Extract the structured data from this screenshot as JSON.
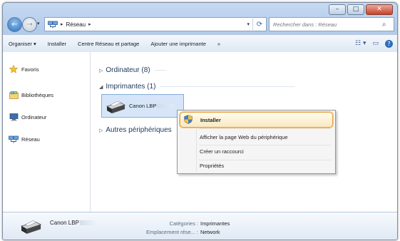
{
  "window": {
    "minimize_glyph": "–",
    "maximize_glyph": "□",
    "close_glyph": "✕"
  },
  "address_bar": {
    "icon": "network-icon",
    "crumbs": [
      "Réseau"
    ],
    "separator": "▸"
  },
  "search": {
    "placeholder": "Rechercher dans : Réseau"
  },
  "toolbar": {
    "organize": "Organiser ▾",
    "install": "Installer",
    "network_center": "Centre Réseau et partage",
    "add_printer": "Ajouter une imprimante",
    "more": "»"
  },
  "sidebar": {
    "items": [
      {
        "label": "Favoris",
        "icon": "star-icon"
      },
      {
        "label": "Bibliothèques",
        "icon": "libraries-icon"
      },
      {
        "label": "Ordinateur",
        "icon": "computer-icon"
      },
      {
        "label": "Réseau",
        "icon": "network-icon"
      }
    ]
  },
  "content": {
    "groups": {
      "computer": "Ordinateur (8)",
      "printers": "Imprimantes (1)",
      "other": "Autres périphériques"
    },
    "device_name": "Canon LBP"
  },
  "context_menu": {
    "items": [
      {
        "label": "Installer",
        "highlighted": true
      },
      {
        "label": "Afficher la page Web du périphérique"
      },
      {
        "label": "Créer un raccourci"
      },
      {
        "label": "Propriétés"
      }
    ]
  },
  "details": {
    "name": "Canon LBP",
    "category_label": "Catégories :",
    "category_value": "Imprimantes",
    "location_label": "Emplacement rése... :",
    "location_value": "Network"
  },
  "colors": {
    "accent": "#3d6fb2",
    "highlight_border": "#e8a23c",
    "selection": "#d6e6f8"
  }
}
